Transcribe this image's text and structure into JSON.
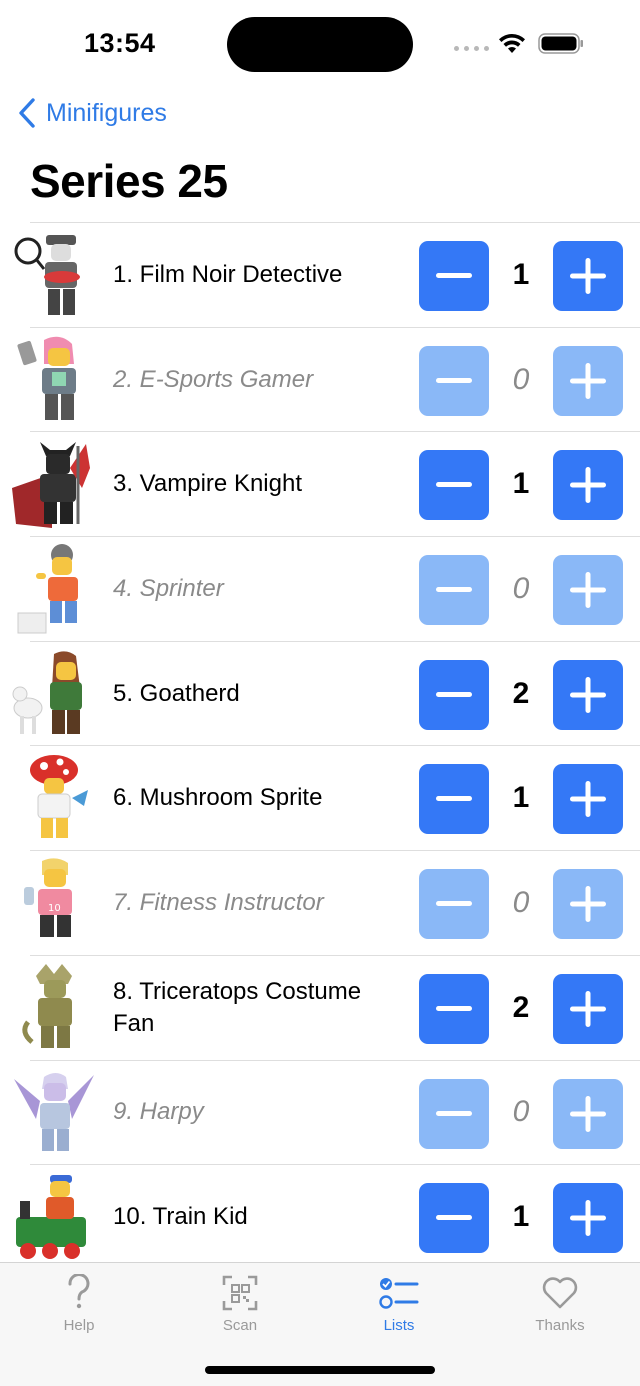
{
  "status": {
    "time": "13:54"
  },
  "nav": {
    "back_label": "Minifigures",
    "title": "Series 25"
  },
  "colors": {
    "accent": "#3478f6",
    "accent_disabled": "#8ab8f7",
    "muted_text": "#8a8a8a"
  },
  "items": [
    {
      "name": "1. Film Noir Detective",
      "count": "1",
      "owned": true
    },
    {
      "name": "2. E-Sports Gamer",
      "count": "0",
      "owned": false
    },
    {
      "name": "3. Vampire Knight",
      "count": "1",
      "owned": true
    },
    {
      "name": "4. Sprinter",
      "count": "0",
      "owned": false
    },
    {
      "name": "5. Goatherd",
      "count": "2",
      "owned": true
    },
    {
      "name": "6. Mushroom Sprite",
      "count": "1",
      "owned": true
    },
    {
      "name": "7. Fitness Instructor",
      "count": "0",
      "owned": false
    },
    {
      "name": "8. Triceratops Costume Fan",
      "count": "2",
      "owned": true
    },
    {
      "name": "9. Harpy",
      "count": "0",
      "owned": false
    },
    {
      "name": "10. Train Kid",
      "count": "1",
      "owned": true
    }
  ],
  "tabs": [
    {
      "label": "Help",
      "icon": "question-icon"
    },
    {
      "label": "Scan",
      "icon": "qr-scan-icon"
    },
    {
      "label": "Lists",
      "icon": "checklist-icon",
      "active": true
    },
    {
      "label": "Thanks",
      "icon": "heart-icon"
    }
  ]
}
